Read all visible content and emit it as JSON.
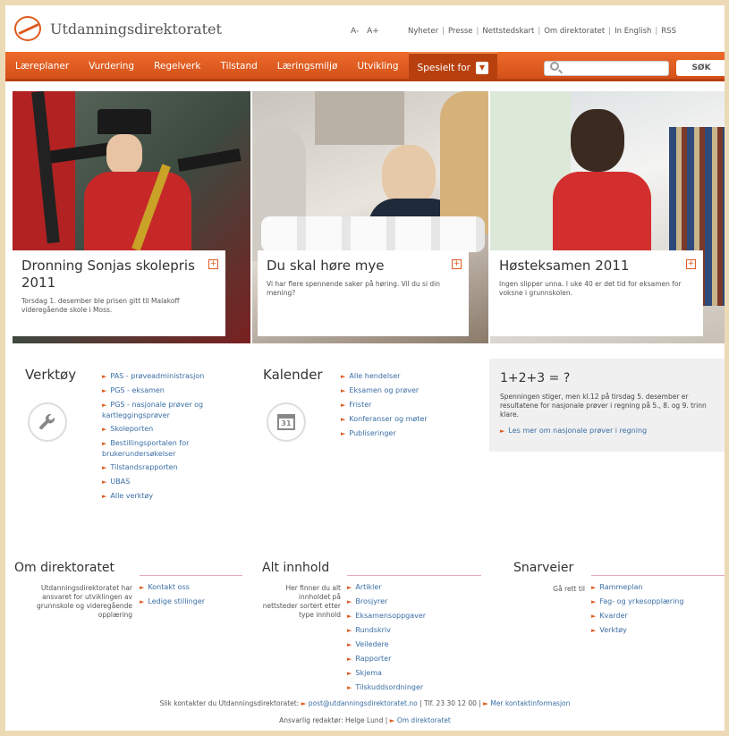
{
  "header": {
    "logo_text": "Utdanningsdirektoratet",
    "font_small": "A-",
    "font_large": "A+",
    "links": [
      "Nyheter",
      "Presse",
      "Nettstedskart",
      "Om direktoratet",
      "In English",
      "RSS"
    ]
  },
  "nav": {
    "items": [
      "Læreplaner",
      "Vurdering",
      "Regelverk",
      "Tilstand",
      "Læringsmiljø",
      "Utvikling"
    ],
    "special": "Spesielt for",
    "caret": "▼",
    "search_placeholder": "",
    "search_button": "SØK"
  },
  "hero": [
    {
      "title": "Dronning Sonjas skolepris 2011",
      "text": "Torsdag 1. desember ble prisen gitt til Malakoff videregående skole i Moss."
    },
    {
      "title": "Du skal høre mye",
      "text": "Vi har flere spennende saker på høring. Vil du si din mening?"
    },
    {
      "title": "Høsteksamen 2011",
      "text": "Ingen slipper unna. I uke 40 er det tid for eksamen for voksne i grunnskolen."
    }
  ],
  "tools": {
    "title": "Verktøy",
    "items": [
      "PAS - prøveadministrasjon",
      "PGS - eksamen",
      "PGS - nasjonale prøver og kartleggingsprøver",
      "Skoleporten",
      "Bestillingsportalen for brukerundersøkelser",
      "Tilstandsrapporten",
      "UBAS",
      "Alle verktøy"
    ]
  },
  "calendar": {
    "title": "Kalender",
    "icon_day": "31",
    "items": [
      "Alle hendelser",
      "Eksamen og prøver",
      "Frister",
      "Konferanser og møter",
      "Publiseringer"
    ]
  },
  "math": {
    "title": "1+2+3 = ?",
    "text": "Spenningen stiger, men kl.12 på tirsdag 5. desember er resultatene for nasjonale prøver i regning på 5., 8. og 9. trinn klare.",
    "link": "Les mer om nasjonale prøver i regning"
  },
  "about": {
    "title": "Om direktoratet",
    "desc": "Utdanningsdirektoratet har ansvaret for utviklingen av grunnskole og videregående opplæring",
    "items": [
      "Kontakt oss",
      "Ledige stillinger"
    ]
  },
  "content": {
    "title": "Alt innhold",
    "desc": "Her finner du alt innholdet på nettsteder sortert etter type innhold",
    "items": [
      "Artikler",
      "Brosjyrer",
      "Eksamensoppgaver",
      "Rundskriv",
      "Veiledere",
      "Rapporter",
      "Skjema",
      "Tilskuddsordninger"
    ]
  },
  "shortcuts": {
    "title": "Snarveier",
    "desc": "Gå rett til",
    "items": [
      "Rammeplan",
      "Fag- og yrkesopplæring",
      "Kvarder",
      "Verktøy"
    ]
  },
  "footer": {
    "line1_text": "Slik kontakter du Utdanningsdirektoratet:",
    "line1_email": "post@utdanningsdirektoratet.no",
    "line1_phone": "Tlf. 23 30 12 00",
    "line1_more": "Mer kontaktinformasjon",
    "line2_text": "Ansvarlig redaktør: Helge Lund",
    "line2_link": "Om direktoratet"
  }
}
